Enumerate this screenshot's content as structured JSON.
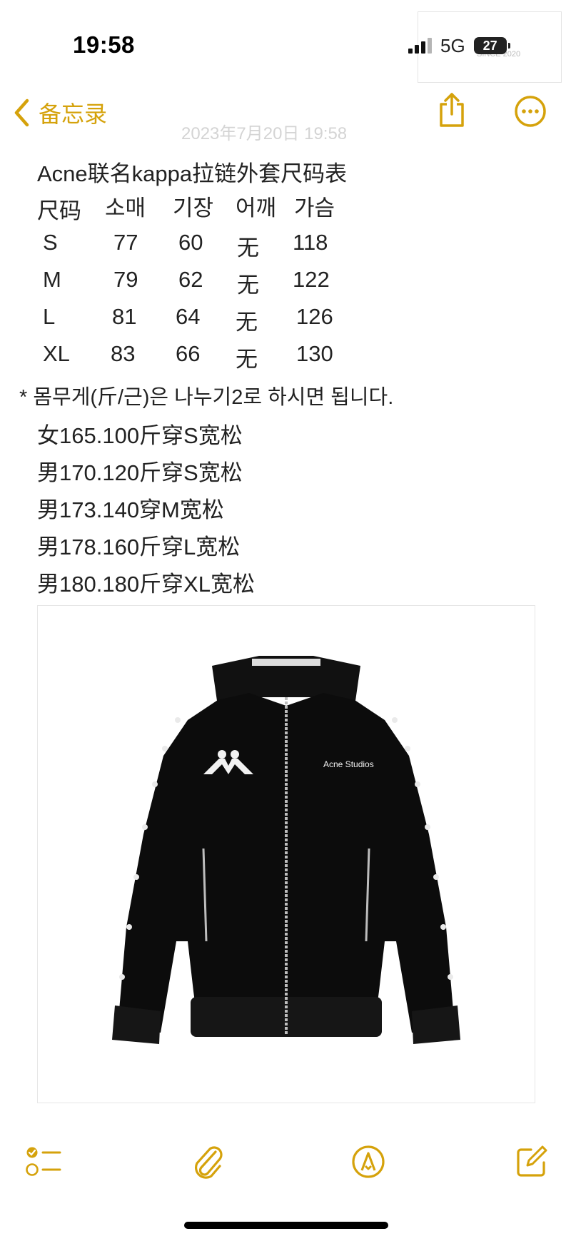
{
  "status_bar": {
    "time": "19:58",
    "network": "5G",
    "battery": "27"
  },
  "watermark": {
    "text": "SINCE 2020"
  },
  "nav": {
    "back_label": "备忘录"
  },
  "note_date": "2023年7月20日 19:58",
  "note": {
    "title": "Acne联名kappa拉链外套尺码表",
    "size_table": {
      "headers": [
        "尺码",
        "소매",
        "기장",
        "어깨",
        "가슴"
      ],
      "rows": [
        [
          "S",
          "77",
          "60",
          "无",
          "118"
        ],
        [
          "M",
          "79",
          "62",
          "无",
          "122"
        ],
        [
          "L",
          "81",
          "64",
          "无",
          "126"
        ],
        [
          "XL",
          "83",
          "66",
          "无",
          "130"
        ]
      ]
    },
    "weight_note": "* 몸무게(斤/근)은 나누기2로 하시면 됩니다.",
    "fit_lines": [
      "女165.100斤穿S宽松",
      "男170.120斤穿S宽松",
      "男173.140穿M宽松",
      "男178.160斤穿L宽松",
      "男180.180斤穿XL宽松"
    ],
    "jacket_brand_text": "Acne Studios"
  },
  "colors": {
    "accent": "#d5a20b",
    "text": "#222222"
  },
  "toolbar": {
    "icons": [
      "checklist-icon",
      "attachment-icon",
      "markup-icon",
      "compose-icon"
    ]
  }
}
